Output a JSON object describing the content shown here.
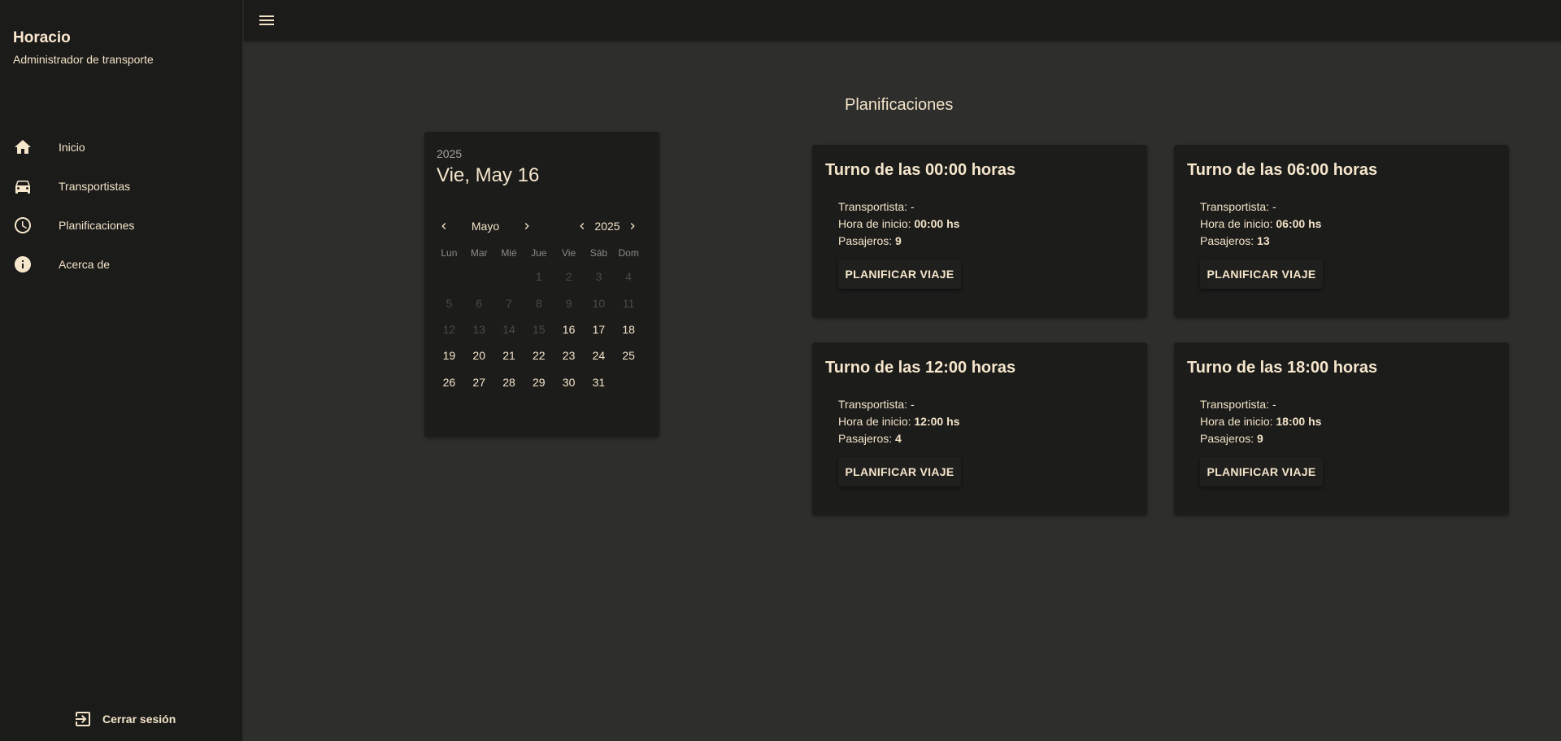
{
  "user": {
    "name": "Horacio",
    "role": "Administrador de transporte"
  },
  "nav": [
    {
      "label": "Inicio",
      "icon": "home-icon"
    },
    {
      "label": "Transportistas",
      "icon": "car-icon"
    },
    {
      "label": "Planificaciones",
      "icon": "clock-icon"
    },
    {
      "label": "Acerca de",
      "icon": "info-icon"
    }
  ],
  "logout": {
    "label": "Cerrar sesión",
    "icon": "logout-icon"
  },
  "page": {
    "title": "Planificaciones"
  },
  "calendar": {
    "header_year": "2025",
    "header_date": "Vie, May 16",
    "month": "Mayo",
    "year": "2025",
    "weekdays": [
      "Lun",
      "Mar",
      "Mié",
      "Jue",
      "Vie",
      "Sáb",
      "Dom"
    ],
    "days": [
      {
        "n": "1",
        "disabled": true
      },
      {
        "n": "2",
        "disabled": true
      },
      {
        "n": "3",
        "disabled": true
      },
      {
        "n": "4",
        "disabled": true
      },
      {
        "n": "5",
        "disabled": true
      },
      {
        "n": "6",
        "disabled": true
      },
      {
        "n": "7",
        "disabled": true
      },
      {
        "n": "8",
        "disabled": true
      },
      {
        "n": "9",
        "disabled": true
      },
      {
        "n": "10",
        "disabled": true
      },
      {
        "n": "11",
        "disabled": true
      },
      {
        "n": "12",
        "disabled": true
      },
      {
        "n": "13",
        "disabled": true
      },
      {
        "n": "14",
        "disabled": true
      },
      {
        "n": "15",
        "disabled": true
      },
      {
        "n": "16",
        "disabled": false
      },
      {
        "n": "17",
        "disabled": false
      },
      {
        "n": "18",
        "disabled": false
      },
      {
        "n": "19",
        "disabled": false
      },
      {
        "n": "20",
        "disabled": false
      },
      {
        "n": "21",
        "disabled": false
      },
      {
        "n": "22",
        "disabled": false
      },
      {
        "n": "23",
        "disabled": false
      },
      {
        "n": "24",
        "disabled": false
      },
      {
        "n": "25",
        "disabled": false
      },
      {
        "n": "26",
        "disabled": false
      },
      {
        "n": "27",
        "disabled": false
      },
      {
        "n": "28",
        "disabled": false
      },
      {
        "n": "29",
        "disabled": false
      },
      {
        "n": "30",
        "disabled": false
      },
      {
        "n": "31",
        "disabled": false
      }
    ]
  },
  "turns": [
    {
      "title": "Turno de las 00:00 horas",
      "carrier_label": "Transportista:",
      "carrier": "-",
      "start_label": "Hora de inicio:",
      "start": "00:00 hs",
      "passengers_label": "Pasajeros:",
      "passengers": "9",
      "button": "PLANIFICAR VIAJE"
    },
    {
      "title": "Turno de las 06:00 horas",
      "carrier_label": "Transportista:",
      "carrier": "-",
      "start_label": "Hora de inicio:",
      "start": "06:00 hs",
      "passengers_label": "Pasajeros:",
      "passengers": "13",
      "button": "PLANIFICAR VIAJE"
    },
    {
      "title": "Turno de las 12:00 horas",
      "carrier_label": "Transportista:",
      "carrier": "-",
      "start_label": "Hora de inicio:",
      "start": "12:00 hs",
      "passengers_label": "Pasajeros:",
      "passengers": "4",
      "button": "PLANIFICAR VIAJE"
    },
    {
      "title": "Turno de las 18:00 horas",
      "carrier_label": "Transportista:",
      "carrier": "-",
      "start_label": "Hora de inicio:",
      "start": "18:00 hs",
      "passengers_label": "Pasajeros:",
      "passengers": "9",
      "button": "PLANIFICAR VIAJE"
    }
  ],
  "colors": {
    "background": "#2e2e2d",
    "surface": "#1c1c1b",
    "text": "#f3e3c8",
    "muted": "#8e8a84",
    "disabled": "#4c4a47"
  }
}
